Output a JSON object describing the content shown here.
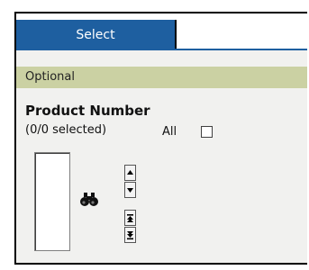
{
  "tabs": [
    {
      "label": "Select",
      "selected": true
    }
  ],
  "section": {
    "label": "Optional"
  },
  "field": {
    "title": "Product Number",
    "selection_count": "(0/0 selected)",
    "all_label": "All",
    "all_checked": false
  },
  "icons": {
    "finder": "binoculars-icon",
    "move_up": "arrow-up-icon",
    "move_down": "arrow-down-icon",
    "move_top": "arrow-to-top-icon",
    "move_bottom": "arrow-to-bottom-icon"
  },
  "colors": {
    "tab_bg": "#1e5fa0",
    "section_band": "#cbd1a3",
    "panel_bg": "#f1f1ef"
  }
}
